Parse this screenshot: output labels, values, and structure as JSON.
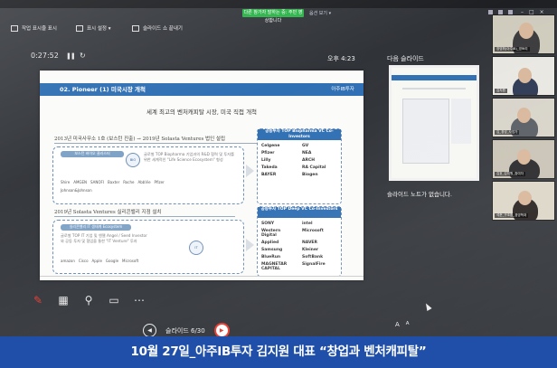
{
  "topbar": {
    "meeting_tag": "다른 참가자 말하는 중: 주민 영상합니다",
    "view_label": "옵션 보기 ▾"
  },
  "toolbar": {
    "items": [
      {
        "label": "작업 표시줄 표시",
        "icon": "taskbar-icon"
      },
      {
        "label": "표시 설정 ▾",
        "icon": "display-icon"
      },
      {
        "label": "슬라이드 쇼 끝내기",
        "icon": "end-show-icon"
      }
    ]
  },
  "presenter": {
    "timer": "0:27:52",
    "clock": "오후 4:23",
    "next_slide_title": "다음 슬라이드",
    "notes_empty": "슬라이드 노트가 없습니다.",
    "slide_counter": "슬라이드 6/30"
  },
  "slide": {
    "header_title": "02. Pioneer (1) 미국시장 개척",
    "header_logo": "아주IB투자",
    "headline": "세계 최고의 벤처캐피탈 시장, 미국 직접 개척",
    "section1": "2013년 미국사무소 1호 (보스턴 진출) → 2019년 Solasta Ventures 법인 설립",
    "section2": "2019년 Solasta Ventures 실리콘밸리 지점 설치",
    "box1_pill": "보스턴 바이오 클러스터",
    "box1_text": "글로벌 TOP Biopharma 기업과의 R&D 협력 및 투자를 위한 세계적인 \"Life Science Ecosystem\" 형성",
    "box1_logos": [
      "Shire",
      "AMGEN",
      "SANOFI",
      "Baxter",
      "Roche",
      "AbbVie",
      "Pfizer",
      "Johnson&Johnson"
    ],
    "box2_pill": "실리콘밸리 IT 생태계 Ecosystem",
    "box2_text": "글로벌 TOP IT 기업 및 엔젤 Angel / Seed Investor 와 공동 투자 및 협업을 통한 \"IT Venture\" 투자",
    "box2_logos": [
      "amazon",
      "Cisco",
      "Apple",
      "Google",
      "Microsoft"
    ],
    "cap1_title": "공동투자 TOP Biopharma VC Co-Investors",
    "cap1_logos": [
      "Celgene",
      "GV",
      "Pfizer",
      "NEA",
      "Lilly",
      "ARCH",
      "Takeda",
      "RA Capital",
      "BAYER",
      "Biogen"
    ],
    "cap2_title": "공동투자 TOP Deep VC Co-Investors",
    "cap2_logos": [
      "SONY",
      "intel",
      "Western Digital",
      "Microsoft",
      "Applied",
      "NAVER",
      "Samsung",
      "Kleiner",
      "BlueRun",
      "SoftBank",
      "MAGNETAR CAPITAL",
      "SignalFire"
    ]
  },
  "participants": [
    {
      "name": "장영휘(아주IB)_영토리"
    },
    {
      "name": "김지원"
    },
    {
      "name": "김_경성_사업가"
    },
    {
      "name": "김호_김지원_참여자"
    },
    {
      "name": "석준_구조환_경영학과"
    }
  ],
  "controls": {
    "font_larger": "A",
    "font_smaller": "A"
  },
  "caption": "10월 27일_아주IB투자 김지원 대표 “창업과 벤처캐피탈”"
}
